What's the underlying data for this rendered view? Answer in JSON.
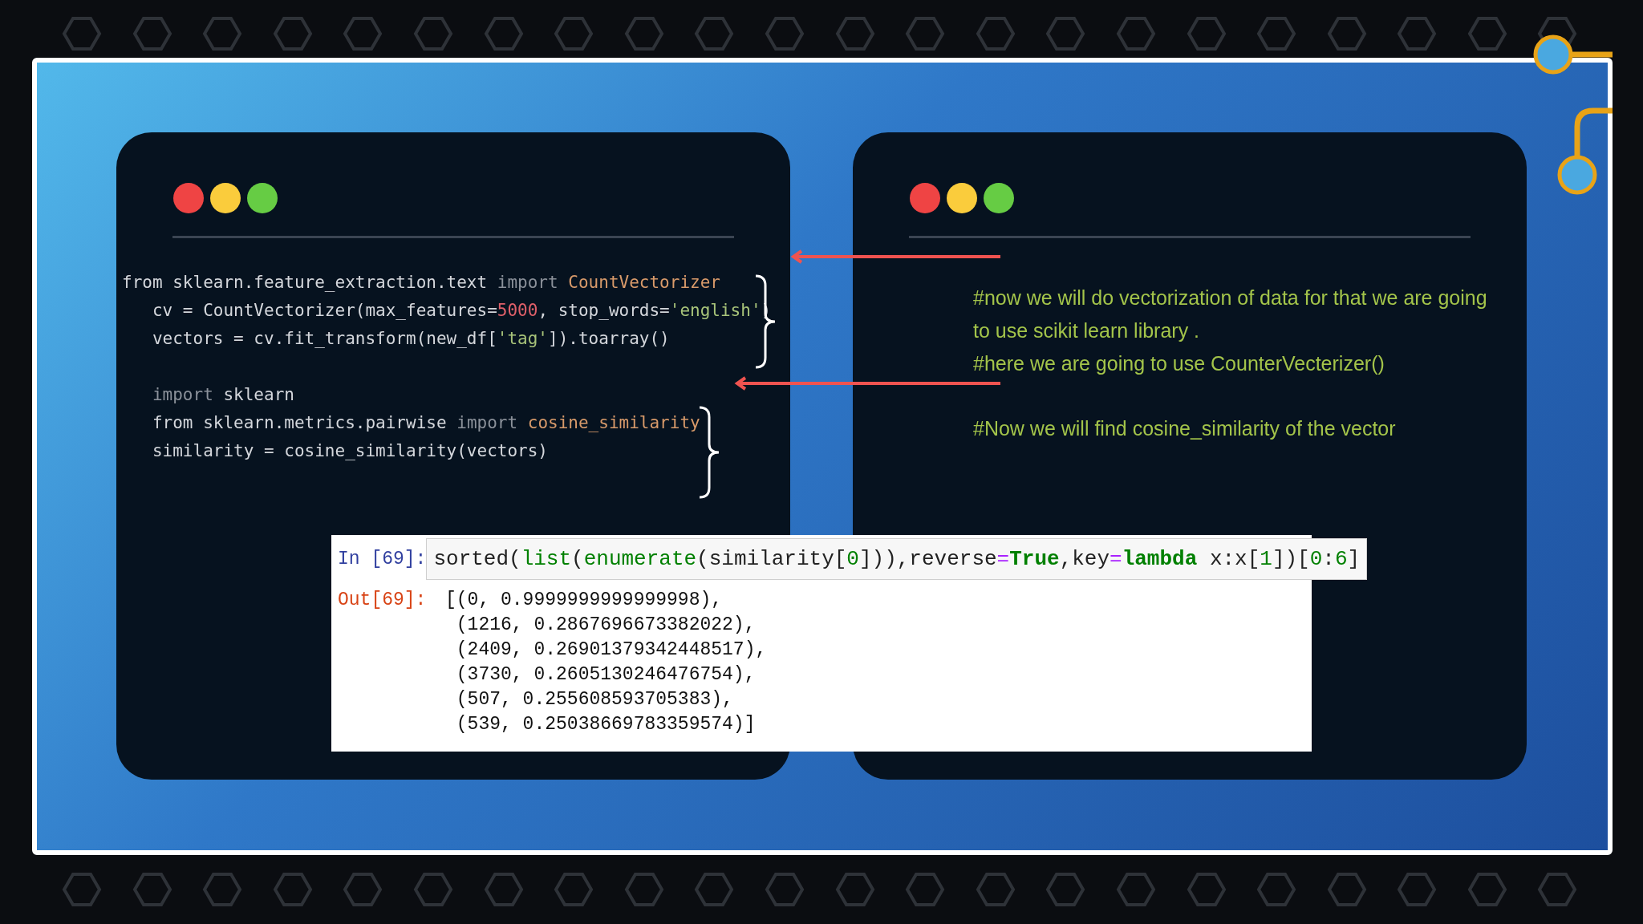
{
  "left_window": {
    "window_controls": [
      {
        "color": "#ef4444"
      },
      {
        "color": "#facc3c"
      },
      {
        "color": "#66cc44"
      }
    ],
    "code_blocks": [
      {
        "lines": [
          [
            {
              "kind": "plain",
              "text": "from sklearn.feature_extraction.text "
            },
            {
              "kind": "keyword",
              "text": "import "
            },
            {
              "kind": "class",
              "text": "CountVectorizer"
            }
          ],
          [
            {
              "kind": "plain",
              "text": "   cv = CountVectorizer(max_features="
            },
            {
              "kind": "number",
              "text": "5000"
            },
            {
              "kind": "plain",
              "text": ", stop_words="
            },
            {
              "kind": "string",
              "text": "'english'"
            },
            {
              "kind": "plain",
              "text": ")"
            }
          ],
          [
            {
              "kind": "plain",
              "text": "   vectors = cv.fit_transform(new_df["
            },
            {
              "kind": "string",
              "text": "'tag'"
            },
            {
              "kind": "plain",
              "text": "]).toarray()"
            }
          ]
        ]
      },
      {
        "lines": [
          [
            {
              "kind": "keyword",
              "text": "   import "
            },
            {
              "kind": "plain",
              "text": "sklearn"
            }
          ],
          [
            {
              "kind": "plain",
              "text": "   from sklearn.metrics.pairwise "
            },
            {
              "kind": "keyword",
              "text": "import "
            },
            {
              "kind": "class",
              "text": "cosine_similarity"
            }
          ],
          [
            {
              "kind": "plain",
              "text": "   similarity = cosine_similarity(vectors)"
            }
          ]
        ]
      }
    ]
  },
  "right_window": {
    "window_controls": [
      {
        "color": "#ef4444"
      },
      {
        "color": "#facc3c"
      },
      {
        "color": "#66cc44"
      }
    ],
    "comments": [
      "#now we will do vectorization of data for that we are going to use scikit learn library .",
      "#here we are going to use CounterVecterizer()",
      "#Now we will find cosine_similarity of the vector"
    ]
  },
  "notebook_cell": {
    "input_prompt": "In [69]:",
    "input": [
      {
        "kind": "plain",
        "text": "sorted("
      },
      {
        "kind": "builtin",
        "text": "list"
      },
      {
        "kind": "plain",
        "text": "("
      },
      {
        "kind": "builtin",
        "text": "enumerate"
      },
      {
        "kind": "plain",
        "text": "(similarity["
      },
      {
        "kind": "number",
        "text": "0"
      },
      {
        "kind": "plain",
        "text": "])),reverse"
      },
      {
        "kind": "operator",
        "text": "="
      },
      {
        "kind": "keyword",
        "text": "True"
      },
      {
        "kind": "plain",
        "text": ",key"
      },
      {
        "kind": "operator",
        "text": "="
      },
      {
        "kind": "keyword",
        "text": "lambda"
      },
      {
        "kind": "plain",
        "text": " x:x["
      },
      {
        "kind": "number",
        "text": "1"
      },
      {
        "kind": "plain",
        "text": "])["
      },
      {
        "kind": "number",
        "text": "0"
      },
      {
        "kind": "plain",
        "text": ":"
      },
      {
        "kind": "number",
        "text": "6"
      },
      {
        "kind": "plain",
        "text": "]"
      }
    ],
    "output_prompt": "Out[69]:",
    "output": [
      "[(0, 0.9999999999999998),",
      " (1216, 0.2867696673382022),",
      " (2409, 0.26901379342448517),",
      " (3730, 0.2605130246476754),",
      " (507, 0.255608593705383),",
      " (539, 0.25038669783359574)]"
    ]
  }
}
